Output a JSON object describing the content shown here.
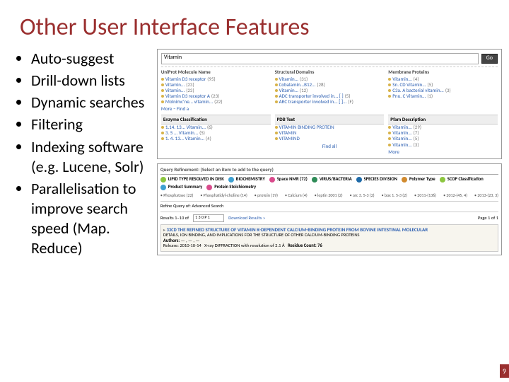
{
  "title": "Other User Interface Features",
  "bullets": {
    "i": [
      "Auto-suggest",
      "Drill-down lists",
      "Dynamic searches",
      "Filtering",
      "Indexing software (e.g. Lucene, Solr)",
      "Parallelisation to improve search speed (Map. Reduce)"
    ]
  },
  "box1": {
    "search": {
      "value": "Vitamin",
      "go": "Go"
    },
    "sect1": {
      "c1h": "UniProt Molecule Name",
      "c2h": "Structural Domains",
      "c3h": "Membrane Proteins",
      "c1": [
        {
          "t": "Vitamin D3 receptor",
          "n": "(95)"
        },
        {
          "t": "Vitamin...",
          "n": "(23)"
        },
        {
          "t": "Vitamin...",
          "n": "(23)"
        },
        {
          "t": "Vitamin D3 receptor A",
          "n": "(23)"
        },
        {
          "t": "Molnimc'ne... vitamin...",
          "n": "(22)"
        }
      ],
      "c2": [
        {
          "t": "Vitamin...",
          "n": "(31)"
        },
        {
          "t": "Cobalamin...B12...",
          "n": "(28)"
        },
        {
          "t": "Vitamin...",
          "n": "(12)"
        },
        {
          "t": "ADC transporter involved in... [ ]",
          "n": "(5)"
        },
        {
          "t": "ARC transporter involved in... [ ]...",
          "n": "(F)"
        }
      ],
      "c3": [
        {
          "t": "Vitamin...",
          "n": "(4)"
        },
        {
          "t": "Sn. CD Vitamin...",
          "n": "(5)"
        },
        {
          "t": "C3a. A bacterial vitamin...",
          "n": "(3)"
        },
        {
          "t": "Pnu. C Vitamin...",
          "n": "(1)"
        }
      ],
      "more": "More – Find a"
    },
    "sect2": {
      "c1h": "Enzyme Classification",
      "c2h": "PDB Text",
      "c3h": "Pfam Description",
      "c1": [
        {
          "t": "1.14. 13... Vitamin...",
          "n": "(6)"
        },
        {
          "t": "3. 5 ... Vitamin...",
          "n": "(5)"
        },
        {
          "t": "1. 4. 13... Vitamin...",
          "n": "(4)"
        }
      ],
      "c2": [
        {
          "t": "VITAMIN BINDING PROTEIN",
          "n": ""
        },
        {
          "t": "VITAMIN",
          "n": ""
        },
        {
          "t": "VITAMIND",
          "n": ""
        }
      ],
      "c3": [
        {
          "t": "Vitamin...",
          "n": "(29)"
        },
        {
          "t": "Vitamin...",
          "n": "(7)"
        },
        {
          "t": "Vitamin...",
          "n": "(5)"
        },
        {
          "t": "Vitamin...",
          "n": "(3)"
        }
      ],
      "findall": "Find all",
      "more": "More"
    }
  },
  "box2": {
    "qhead": "Query Refinement: (Select an item to add to the query)",
    "tags": [
      {
        "c": "#8cc63f",
        "l": "LIPID TYPE RESOLVED IN DISK"
      },
      {
        "c": "#3ea0d1",
        "l": "BIOCHEMISTRY"
      },
      {
        "c": "#d94b8c",
        "l": "Space NMR",
        "n": "(72)"
      },
      {
        "c": "#2e8b57",
        "l": "VIRUS/BACTERIA"
      },
      {
        "c": "#1e6aa8",
        "l": "SPECIES DIVISION"
      },
      {
        "c": "#d18a2e",
        "l": "Polymer Type"
      },
      {
        "c": "#8cc63f",
        "l": "SCOP Classification"
      },
      {
        "c": "#3ea0d1",
        "l": "Product Summary"
      },
      {
        "c": "#d94b8c",
        "l": "Protein Stoichiometry"
      }
    ],
    "sub": [
      "Phosphatase (22)",
      "Phosphatidyl-choline (14)",
      "protein (19)",
      "Calcium (4)",
      "leptin 2001 (2)",
      "arc 3. 5-3 (2)",
      "box 1. 5-3 (2)",
      "2011-(136)",
      "2012-(45, 4)",
      "2013-(23, 3)"
    ],
    "bar": {
      "refine": "Refine Query of: Advanced Search"
    },
    "row": {
      "results": "Results 1–10 of",
      "qbox": "1 3 0 P 1",
      "dl": "Download Results  »",
      "pg": "Page 1 of 1"
    },
    "res": {
      "id": "33CD",
      "title": "THE REFINED STRUCTURE OF VITAMIN K-DEPENDENT CALCIUM-BINDING PROTEIN FROM BOVINE INTESTINAL MOLECULAR",
      "sub": "DETAILS, ION BINDING, AND IMPLICATIONS FOR THE STRUCTURE OF OTHER CALCIUM-BINDING PROTEINS",
      "authors": "Authors:",
      "release": "Release:   2010-10-14",
      "method": "X-ray DIFFRACTION with resolution of 2.1 Å",
      "residue": "Residue Count:   76"
    }
  },
  "pgnum": "9"
}
